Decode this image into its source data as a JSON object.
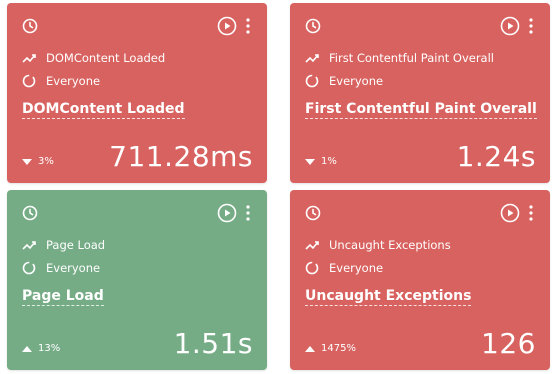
{
  "cards": [
    {
      "metric": "DOMContent Loaded",
      "segment": "Everyone",
      "title": "DOMContent Loaded",
      "change": "3%",
      "direction": "down",
      "value": "711.28ms",
      "color": "#d8625f"
    },
    {
      "metric": "First Contentful Paint Overall",
      "segment": "Everyone",
      "title": "First Contentful Paint Overall",
      "change": "1%",
      "direction": "down",
      "value": "1.24s",
      "color": "#d8625f"
    },
    {
      "metric": "Page Load",
      "segment": "Everyone",
      "title": "Page Load",
      "change": "13%",
      "direction": "up",
      "value": "1.51s",
      "color": "#75ac86"
    },
    {
      "metric": "Uncaught Exceptions",
      "segment": "Everyone",
      "title": "Uncaught Exceptions",
      "change": "1475%",
      "direction": "up",
      "value": "126",
      "color": "#d8625f"
    }
  ],
  "icons": [
    "clock-icon",
    "play-icon",
    "more-vertical-icon",
    "trend-icon",
    "segment-icon",
    "triangle-icon"
  ]
}
